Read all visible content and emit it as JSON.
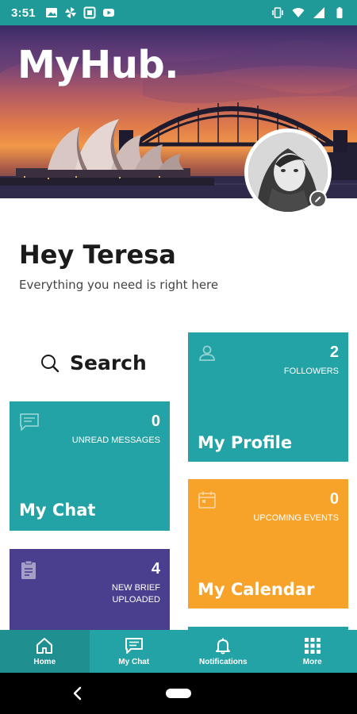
{
  "status_bar": {
    "time": "3:51",
    "left_icons": [
      "image-icon",
      "pinwheel-icon",
      "security-icon",
      "youtube-icon"
    ],
    "right_icons": [
      "vibrate-icon",
      "wifi-icon",
      "signal-icon",
      "battery-icon"
    ]
  },
  "hero": {
    "app_title": "MyHub."
  },
  "greeting": {
    "title": "Hey Teresa",
    "subtitle": "Everything you need is right here"
  },
  "search": {
    "label": "Search"
  },
  "tiles": {
    "chat": {
      "count": "0",
      "caption": "UNREAD MESSAGES",
      "title": "My Chat",
      "icon": "chat-icon",
      "color": "#23a3a5"
    },
    "brief": {
      "count": "4",
      "caption": "NEW BRIEF UPLOADED",
      "title": "",
      "icon": "clipboard-icon",
      "color": "#4a3f8f"
    },
    "profile": {
      "count": "2",
      "caption": "FOLLOWERS",
      "title": "My Profile",
      "icon": "user-icon",
      "color": "#23a3a5"
    },
    "calendar": {
      "count": "0",
      "caption": "UPCOMING EVENTS",
      "title": "My Calendar",
      "icon": "calendar-icon",
      "color": "#f7a32a"
    }
  },
  "bottom_nav": {
    "items": [
      {
        "label": "Home",
        "icon": "home-icon",
        "active": true
      },
      {
        "label": "My Chat",
        "icon": "chat-icon",
        "active": false
      },
      {
        "label": "Notifications",
        "icon": "bell-icon",
        "active": false
      },
      {
        "label": "More",
        "icon": "grid-icon",
        "active": false
      }
    ]
  },
  "colors": {
    "accent": "#23a3a5",
    "status_bar": "#1f9a99",
    "brief": "#4a3f8f",
    "calendar": "#f7a32a"
  }
}
